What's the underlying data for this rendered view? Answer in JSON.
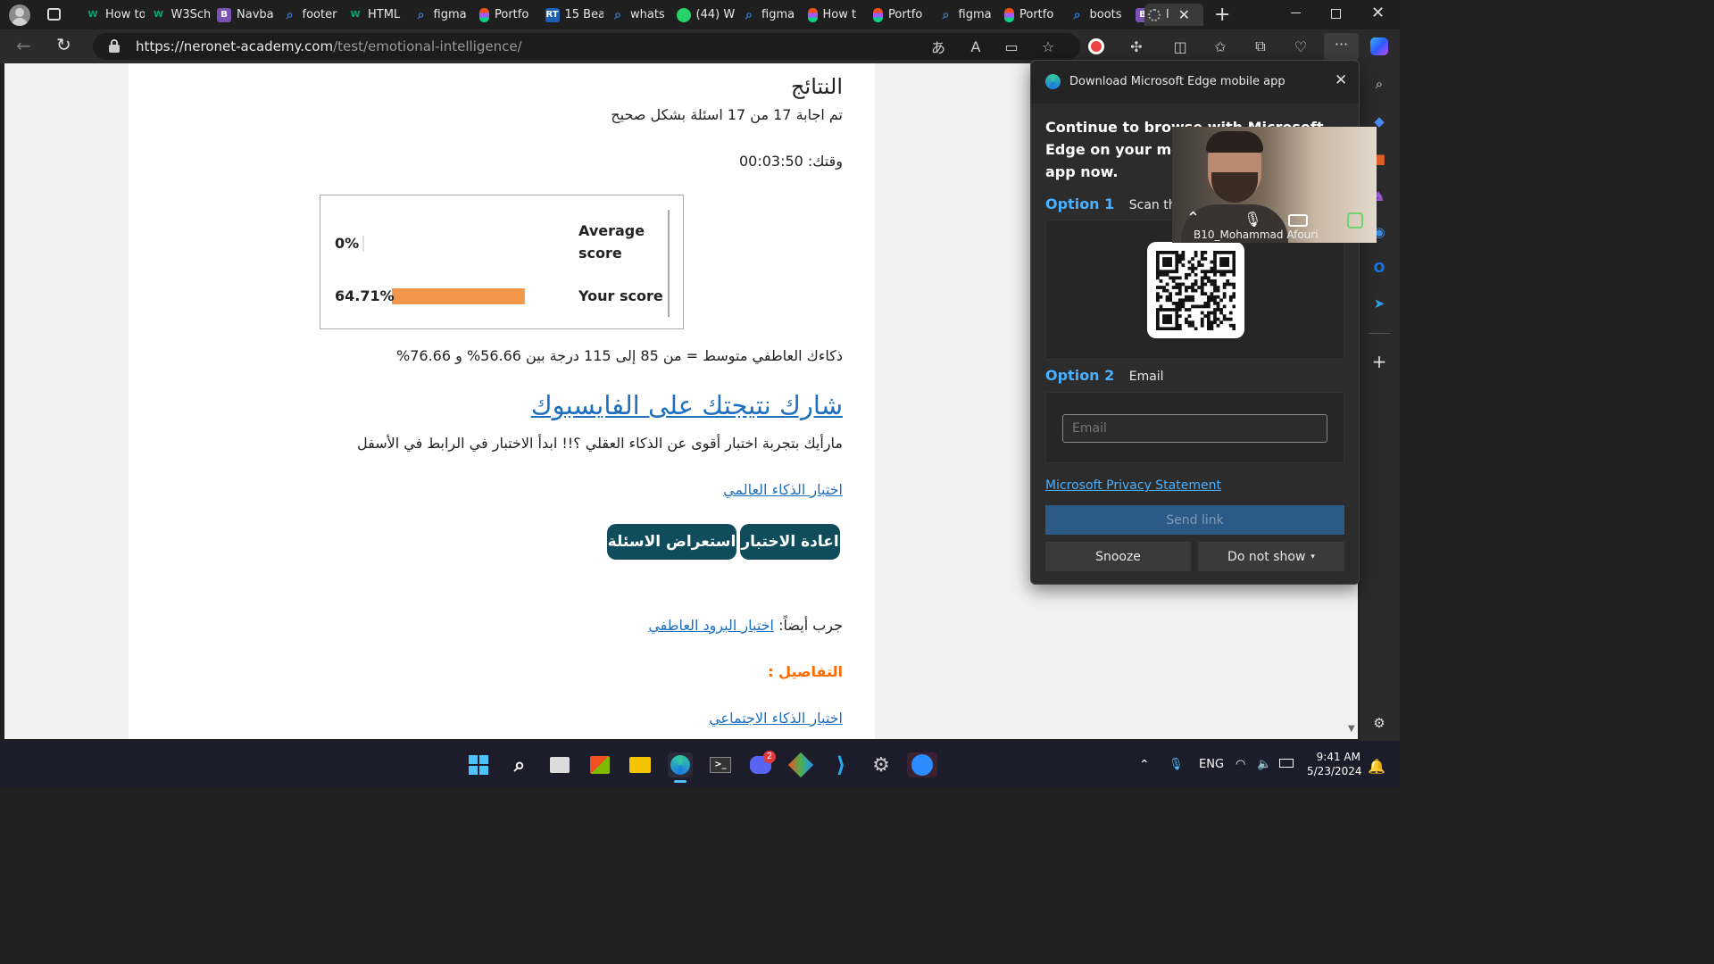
{
  "tabs": [
    {
      "label": "How to",
      "fav": "W",
      "color": "#04aa6d"
    },
    {
      "label": "W3Sch",
      "fav": "W",
      "color": "#04aa6d"
    },
    {
      "label": "Navba",
      "fav": "B",
      "color": "#7952b3"
    },
    {
      "label": "footer",
      "fav": "search-icon",
      "color": "#3a7bd5"
    },
    {
      "label": "HTML",
      "fav": "W",
      "color": "#04aa6d"
    },
    {
      "label": "figma",
      "fav": "search-icon",
      "color": "#3a7bd5"
    },
    {
      "label": "Portfo",
      "fav": "figma-icon",
      "color": "#f24e1e"
    },
    {
      "label": "15 Bea",
      "fav": "RT",
      "color": "#1a5fb4"
    },
    {
      "label": "whats",
      "fav": "search-icon",
      "color": "#3a7bd5"
    },
    {
      "label": "(44) W",
      "fav": "whatsapp-icon",
      "color": "#25d366"
    },
    {
      "label": "figma",
      "fav": "search-icon",
      "color": "#3a7bd5"
    },
    {
      "label": "How t",
      "fav": "figma-icon",
      "color": "#f24e1e"
    },
    {
      "label": "Portfo",
      "fav": "figma-icon",
      "color": "#f24e1e"
    },
    {
      "label": "figma",
      "fav": "search-icon",
      "color": "#3a7bd5"
    },
    {
      "label": "Portfo",
      "fav": "figma-icon",
      "color": "#f24e1e"
    },
    {
      "label": "boots",
      "fav": "search-icon",
      "color": "#3a7bd5"
    },
    {
      "label": "Image",
      "fav": "B",
      "color": "#7952b3"
    }
  ],
  "active_tab_label": "ا",
  "url": {
    "base": "https://neronet-academy.com",
    "path": "/test/emotional-intelligence/"
  },
  "page": {
    "heading": "النتائج",
    "answered": "تم اجابة 17 من 17 اسئلة بشكل صحيح",
    "time": "وقتك: 00:03:50",
    "result_text": "ذكاءك العاطفي متوسط = من 85 إلى 115 درجة بين 56.66% و 76.66%",
    "share_link": "شارك نتيجتك على الفايسبوك",
    "promo": "مارأيك بتجربة اختبار أقوى عن الذكاء العقلي ؟!! ابدأ الاختبار في الرابط في الأسفل",
    "global_test_link": "اختبار الذكاء العالمي",
    "retake_button": "اعادة الاختبار",
    "review_button": "استعراض الاسئلة",
    "try_also_label": "جرب أيضاً:",
    "try_also_link": "اختبار البرود العاطفي",
    "details_label": "التفاصيل :",
    "social_test_link": "اختبار الذكاء الاجتماعي"
  },
  "chart_data": {
    "type": "bar",
    "categories": [
      "Average score",
      "Your score"
    ],
    "values": [
      0,
      64.71
    ],
    "value_labels": [
      "0%",
      "64.71%"
    ],
    "xlim": [
      0,
      100
    ],
    "bar_color": "#f5974a"
  },
  "flyout": {
    "title": "Download Microsoft Edge mobile app",
    "headline": "Continue to browse with Microsoft Edge on your mobile device. Get the app now.",
    "option1_label": "Option 1",
    "option1_text": "Scan the QR code",
    "option2_label": "Option 2",
    "option2_text": "Email",
    "email_placeholder": "Email",
    "privacy_link": "Microsoft Privacy Statement",
    "send_button": "Send link",
    "snooze_button": "Snooze",
    "do_not_show_button": "Do not show"
  },
  "video": {
    "participant": "B10_Mohammad Afouri"
  },
  "taskbar": {
    "lang": "ENG",
    "time": "9:41 AM",
    "date": "5/23/2024",
    "discord_badge": "2"
  },
  "colors": {
    "accent_link": "#1f6fbf",
    "details_orange": "#ff6a00",
    "button_teal": "#0f4c5c"
  }
}
